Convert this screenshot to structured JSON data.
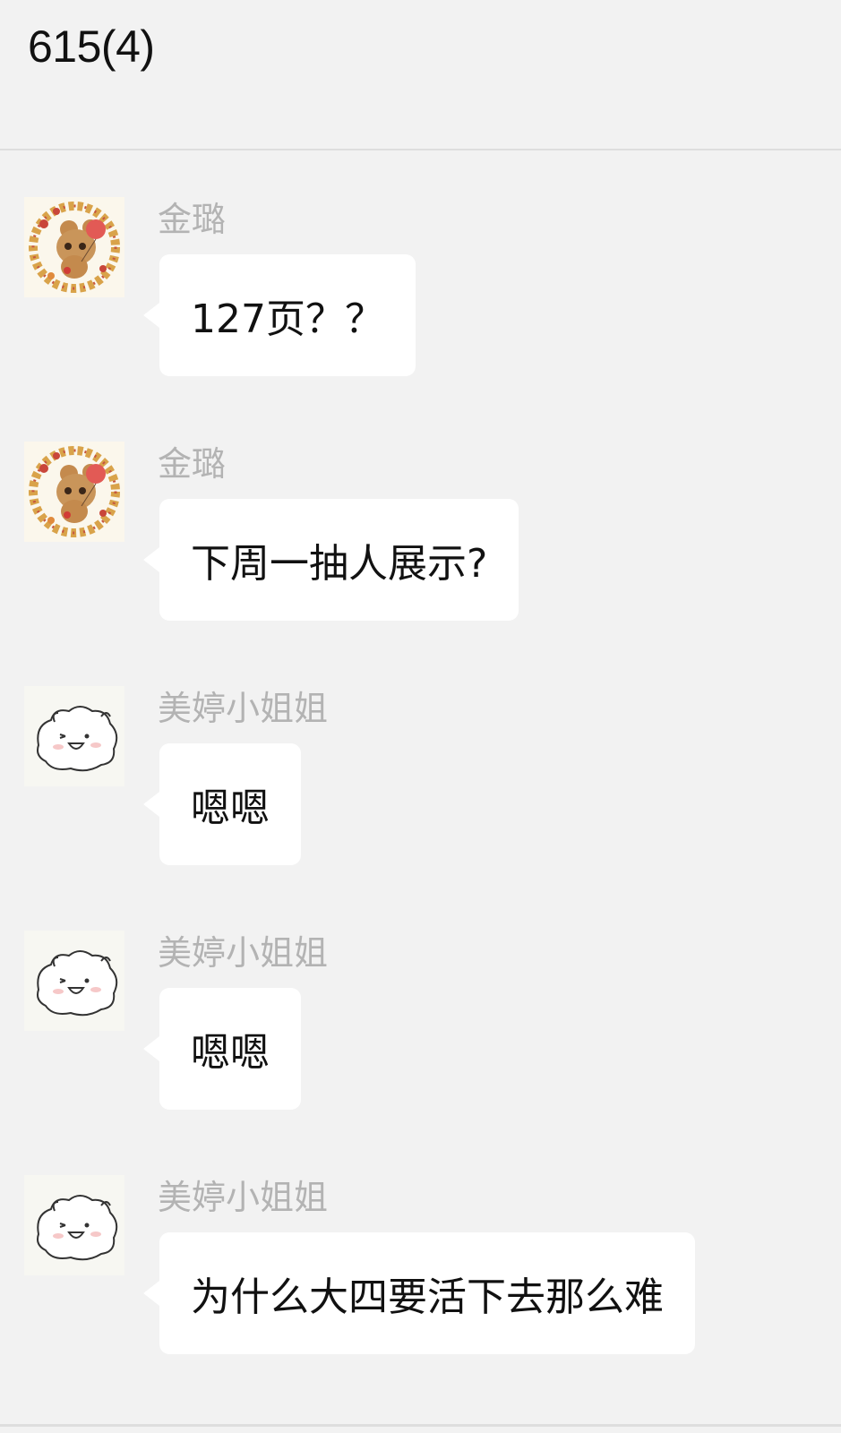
{
  "header": {
    "title": "615(4)"
  },
  "messages": [
    {
      "sender": "金璐",
      "avatar": "bear-balloon-avatar",
      "text": "127页？？"
    },
    {
      "sender": "金璐",
      "avatar": "bear-balloon-avatar",
      "text": "下周一抽人展示?"
    },
    {
      "sender": "美婷小姐姐",
      "avatar": "fluffy-creature-avatar",
      "text": "嗯嗯"
    },
    {
      "sender": "美婷小姐姐",
      "avatar": "fluffy-creature-avatar",
      "text": "嗯嗯"
    },
    {
      "sender": "美婷小姐姐",
      "avatar": "fluffy-creature-avatar",
      "text": "为什么大四要活下去那么难"
    }
  ],
  "colors": {
    "background": "#f2f2f2",
    "bubble": "#ffffff",
    "sender_name": "#b3b3b3",
    "divider": "#dedede"
  }
}
